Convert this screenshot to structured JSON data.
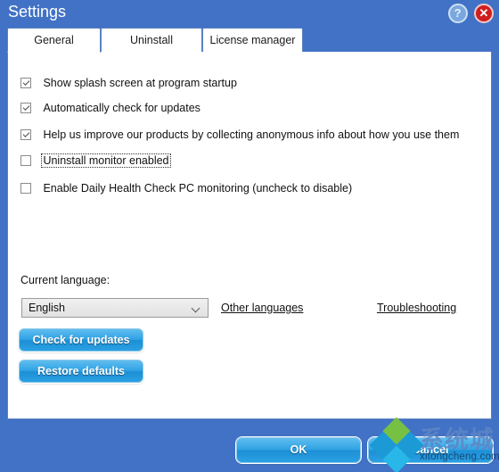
{
  "window": {
    "title": "Settings",
    "accent_color": "#4272c6",
    "panel_color": "#ffffff"
  },
  "caption": {
    "help_icon": "help-question-icon",
    "help_glyph": "?",
    "close_icon": "close-x-icon",
    "close_glyph": "✕"
  },
  "tabs": [
    {
      "label": "General",
      "active": true
    },
    {
      "label": "Uninstall",
      "active": false
    },
    {
      "label": "License manager",
      "active": false
    }
  ],
  "checkboxes": [
    {
      "label": "Show splash screen at program startup",
      "checked": true,
      "focused": false
    },
    {
      "label": "Automatically check for updates",
      "checked": true,
      "focused": false
    },
    {
      "label": "Help us improve our products by collecting anonymous info about how you use them",
      "checked": true,
      "focused": false
    },
    {
      "label": "Uninstall monitor enabled",
      "checked": false,
      "focused": true
    },
    {
      "label": "Enable Daily Health Check PC monitoring (uncheck to disable)",
      "checked": false,
      "focused": false
    }
  ],
  "language": {
    "label": "Current language:",
    "selected": "English",
    "dropdown_icon": "chevron-down-icon",
    "other_languages_link": "Other languages",
    "troubleshooting_link": "Troubleshooting"
  },
  "actions": {
    "check_updates": "Check for updates",
    "restore_defaults": "Restore defaults"
  },
  "footer": {
    "ok": "OK",
    "cancel": "Cancel"
  },
  "watermark": {
    "logo_icon": "four-diamond-logo-icon",
    "brand_cn": "系统城",
    "url": "xitongcheng.com"
  }
}
